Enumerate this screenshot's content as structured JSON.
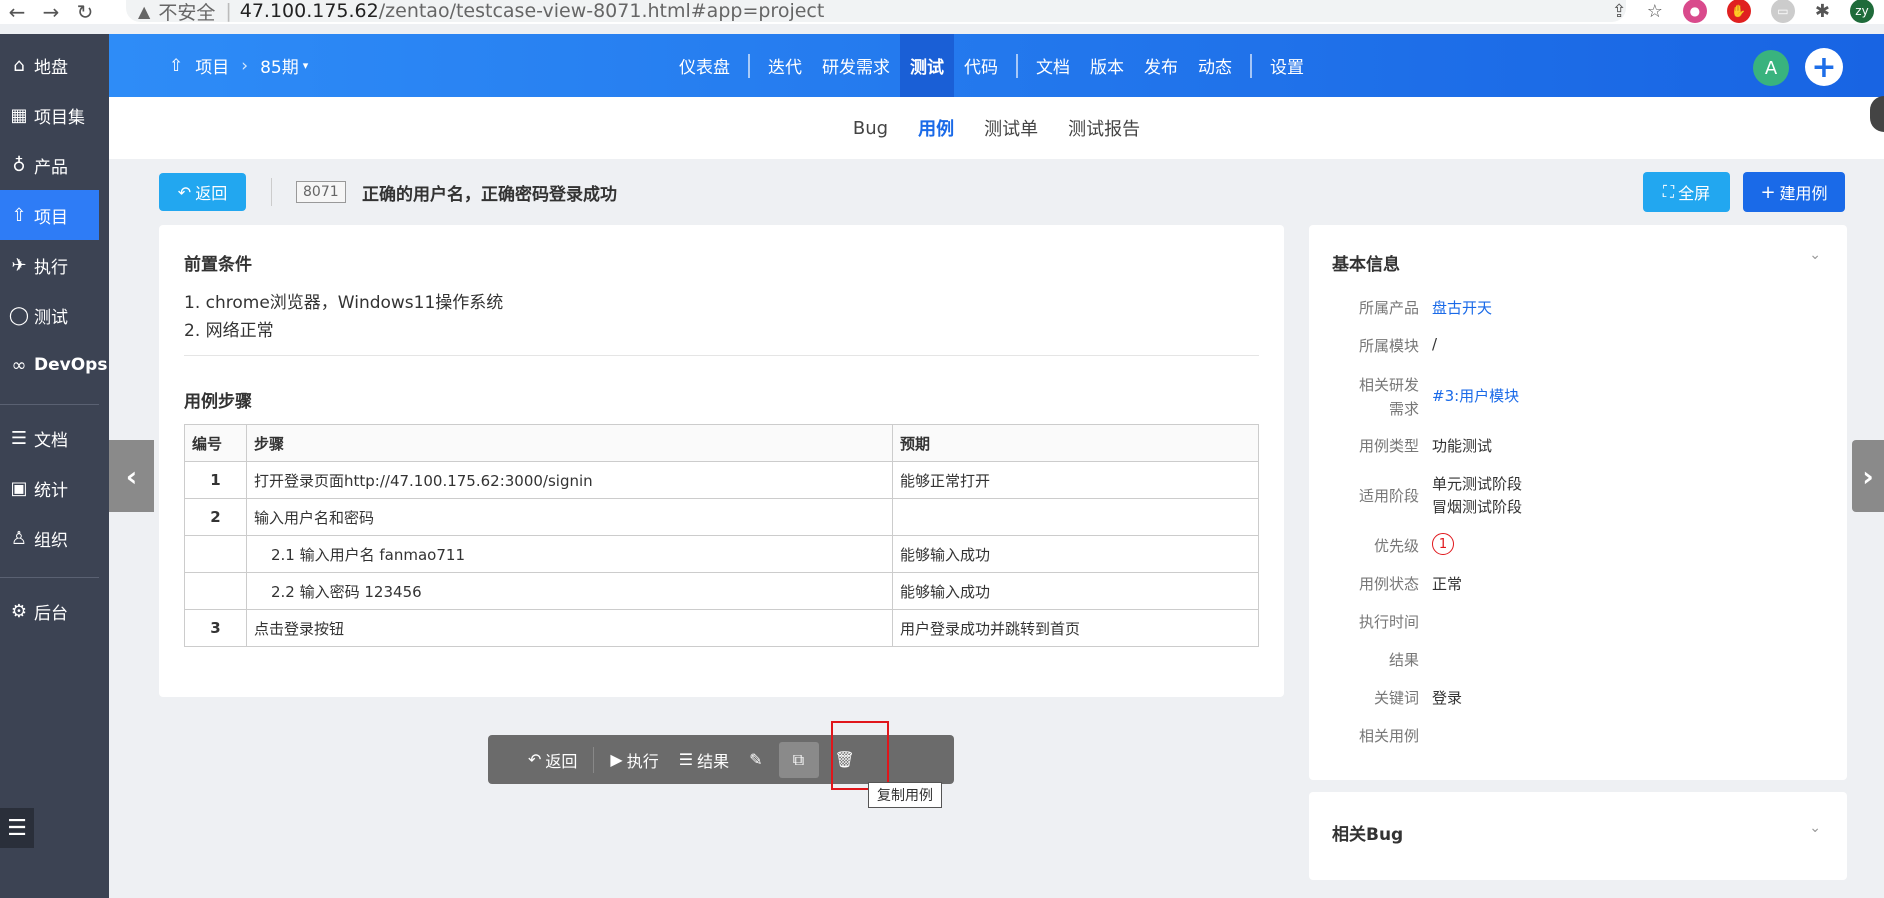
{
  "browser": {
    "insecure_label": "不安全",
    "url_host": "47.100.175.62",
    "url_path": "/zentao/testcase-view-8071.html#app=project",
    "profile_initials": "zy"
  },
  "sidebar": {
    "items": [
      {
        "label": "地盘",
        "icon": "home-icon"
      },
      {
        "label": "项目集",
        "icon": "grid-icon"
      },
      {
        "label": "产品",
        "icon": "bulb-icon"
      },
      {
        "label": "项目",
        "icon": "rocket-icon"
      },
      {
        "label": "执行",
        "icon": "run-icon"
      },
      {
        "label": "测试",
        "icon": "search-icon"
      },
      {
        "label": "DevOps",
        "icon": "infinity-icon"
      },
      {
        "label": "文档",
        "icon": "doc-icon"
      },
      {
        "label": "统计",
        "icon": "chart-icon"
      },
      {
        "label": "组织",
        "icon": "user-icon"
      },
      {
        "label": "后台",
        "icon": "gear-icon"
      }
    ],
    "active": "项目"
  },
  "header": {
    "crumb_project": "项目",
    "crumb_iteration": "85期",
    "nav": [
      "仪表盘",
      "迭代",
      "研发需求",
      "测试",
      "代码",
      "文档",
      "版本",
      "发布",
      "动态",
      "设置"
    ],
    "active_nav": "测试",
    "avatar_initial": "A"
  },
  "subnav": {
    "items": [
      "Bug",
      "用例",
      "测试单",
      "测试报告"
    ],
    "active": "用例"
  },
  "title_bar": {
    "back_label": "返回",
    "case_id": "8071",
    "case_title": "正确的用户名，正确密码登录成功",
    "fullscreen_label": "全屏",
    "create_label": "建用例"
  },
  "main": {
    "precondition_title": "前置条件",
    "preconditions": [
      "1. chrome浏览器，Windows11操作系统",
      "2. 网络正常"
    ],
    "steps_title": "用例步骤",
    "columns": [
      "编号",
      "步骤",
      "预期"
    ],
    "rows": [
      {
        "num": "1",
        "step": "打开登录页面http://47.100.175.62:3000/signin",
        "expect": "能够正常打开"
      },
      {
        "num": "2",
        "step": "输入用户名和密码",
        "expect": ""
      },
      {
        "num": "",
        "step": "2.1  输入用户名 fanmao711",
        "expect": "能够输入成功"
      },
      {
        "num": "",
        "step": "2.2  输入密码 123456",
        "expect": "能够输入成功"
      },
      {
        "num": "3",
        "step": "点击登录按钮",
        "expect": "用户登录成功并跳转到首页"
      }
    ]
  },
  "toolbar": {
    "back_label": "返回",
    "run_label": "执行",
    "result_label": "结果",
    "copy_tooltip": "复制用例"
  },
  "info": {
    "title": "基本信息",
    "rows": [
      {
        "label": "所属产品",
        "value": "盘古开天",
        "link": true
      },
      {
        "label": "所属模块",
        "value": "/"
      },
      {
        "label": "相关研发需求",
        "value": "#3:用户模块",
        "link": true
      },
      {
        "label": "用例类型",
        "value": "功能测试"
      },
      {
        "label": "适用阶段",
        "value": "单元测试阶段",
        "value2": "冒烟测试阶段"
      },
      {
        "label": "优先级",
        "value": "1"
      },
      {
        "label": "用例状态",
        "value": "正常"
      },
      {
        "label": "执行时间",
        "value": ""
      },
      {
        "label": "结果",
        "value": ""
      },
      {
        "label": "关键词",
        "value": "登录"
      },
      {
        "label": "相关用例",
        "value": ""
      }
    ],
    "label_demand_1": "相关研发",
    "label_demand_2": "需求"
  },
  "bug_panel": {
    "title": "相关Bug"
  },
  "colors": {
    "primary": "#1a6ae8",
    "accent": "#22a7f0",
    "sidebar_bg": "#3c4353",
    "danger": "#e0161b"
  }
}
